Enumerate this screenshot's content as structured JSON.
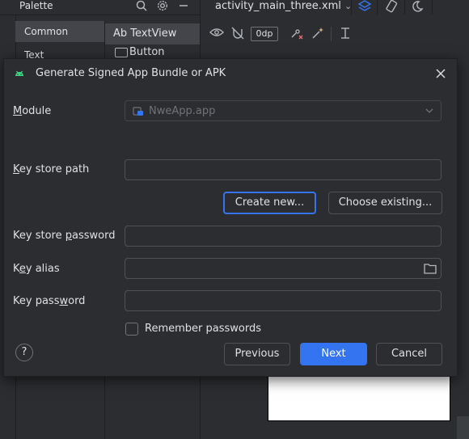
{
  "palette": {
    "title": "Palette",
    "categories": [
      {
        "label": "Common",
        "selected": true
      },
      {
        "label": "Text",
        "selected": false
      }
    ],
    "items": [
      {
        "label": "Ab TextView",
        "selected": true
      },
      {
        "label": "Button",
        "selected": false
      }
    ],
    "header_icons": [
      "search-icon",
      "settings-icon",
      "minimize-icon"
    ]
  },
  "editor": {
    "file_tab": "activity_main_three.xml",
    "toolbar": {
      "dp_value": "0dp",
      "icons": [
        "eye-icon",
        "magnet-off-icon",
        "clear-constraints-icon",
        "infer-constraints-icon",
        "magic-wand-icon",
        "guidelines-icon"
      ]
    }
  },
  "dialog": {
    "title": "Generate Signed App Bundle or APK",
    "module": {
      "label_prefix": "",
      "label_mnemonic": "M",
      "label_rest": "odule",
      "value": "NweApp.app"
    },
    "keystore_path": {
      "label_prefix": "",
      "label_mnemonic": "K",
      "label_rest": "ey store path",
      "value": ""
    },
    "create_new_label": "Create new...",
    "choose_existing_label": "Choose existing...",
    "keystore_password": {
      "label_prefix": "Key store ",
      "label_mnemonic": "p",
      "label_rest": "assword",
      "value": ""
    },
    "key_alias": {
      "label_prefix": "K",
      "label_mnemonic": "e",
      "label_rest": "y alias",
      "value": ""
    },
    "key_password": {
      "label_prefix": "Key pass",
      "label_mnemonic": "w",
      "label_rest": "ord",
      "value": ""
    },
    "remember_passwords_label": "Remember passwords",
    "remember_checked": false,
    "help_symbol": "?",
    "previous_label": "Previous",
    "next_label": "Next",
    "cancel_label": "Cancel"
  },
  "colors": {
    "accent": "#3574f0",
    "background": "#2b2d30",
    "text": "#dfe1e5",
    "android_green": "#3ddc84"
  }
}
